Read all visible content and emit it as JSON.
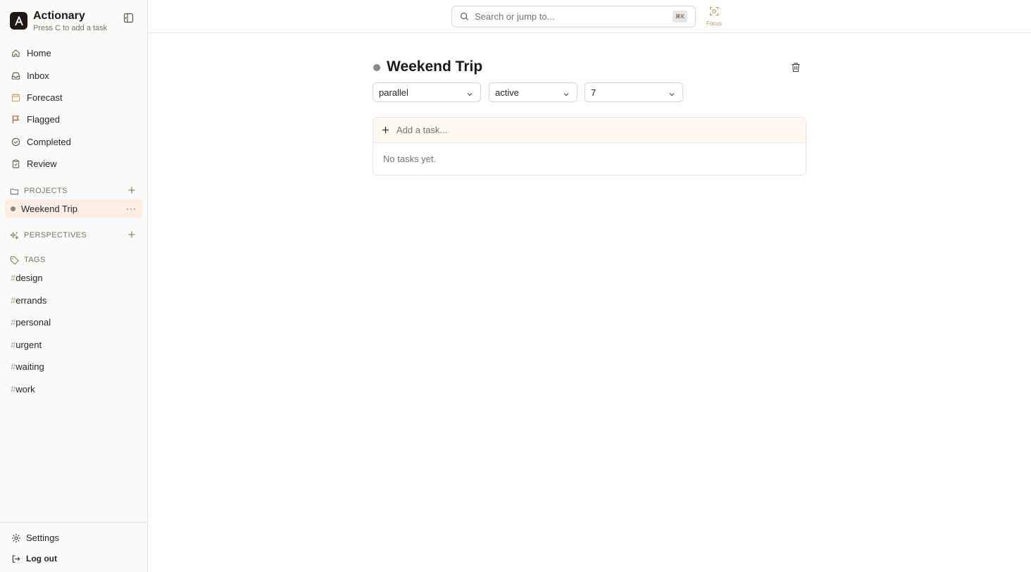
{
  "app": {
    "name": "Actionary",
    "hint": "Press C to add a task"
  },
  "nav": [
    {
      "label": "Home",
      "icon": "home-icon"
    },
    {
      "label": "Inbox",
      "icon": "inbox-icon"
    },
    {
      "label": "Forecast",
      "icon": "calendar-icon"
    },
    {
      "label": "Flagged",
      "icon": "flag-icon"
    },
    {
      "label": "Completed",
      "icon": "check-circle-icon"
    },
    {
      "label": "Review",
      "icon": "clipboard-icon"
    }
  ],
  "sections": {
    "projects": "PROJECTS",
    "perspectives": "PERSPECTIVES",
    "tags": "TAGS"
  },
  "projects": [
    {
      "label": "Weekend Trip",
      "color": "#8a8785"
    }
  ],
  "tags": [
    {
      "hash": "#",
      "name": "design"
    },
    {
      "hash": "#",
      "name": "errands"
    },
    {
      "hash": "#",
      "name": "personal"
    },
    {
      "hash": "#",
      "name": "urgent"
    },
    {
      "hash": "#",
      "name": "waiting"
    },
    {
      "hash": "#",
      "name": "work"
    }
  ],
  "footer": {
    "settings": "Settings",
    "logout": "Log out"
  },
  "topbar": {
    "search_placeholder": "Search or jump to...",
    "shortcut": "⌘K",
    "focus_label": "Focus"
  },
  "project": {
    "title": "Weekend Trip",
    "type_value": "parallel",
    "status_value": "active",
    "review_value": "7",
    "add_task_placeholder": "Add a task...",
    "empty_text": "No tasks yet."
  },
  "colors": {
    "accent": "#b8935a",
    "selected_bg": "#fbeee5",
    "add_row_bg": "#fcf8f2"
  }
}
